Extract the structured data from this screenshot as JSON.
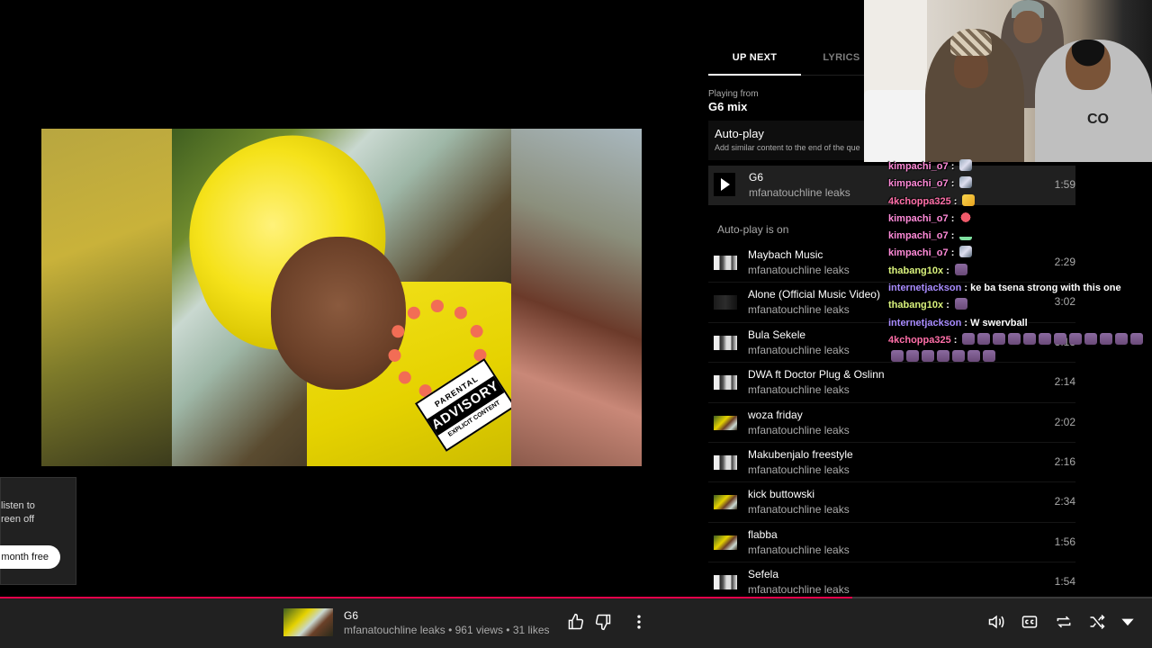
{
  "tabs": {
    "up_next": "UP NEXT",
    "lyrics": "LYRICS"
  },
  "playing_from": {
    "label": "Playing from",
    "name": "G6 mix"
  },
  "autoplay": {
    "title": "Auto-play",
    "description": "Add similar content to the end of the que",
    "status": "Auto-play is on"
  },
  "now_playing": {
    "title": "G6",
    "artist": "mfanatouchline leaks",
    "duration": "1:59"
  },
  "queue": [
    {
      "title": "Maybach Music",
      "artist": "mfanatouchline leaks",
      "duration": "2:29",
      "thumb": "t-bw"
    },
    {
      "title": "Alone (Official Music Video)",
      "artist": "mfanatouchline leaks",
      "duration": "3:02",
      "thumb": "t-dark"
    },
    {
      "title": "Bula Sekele",
      "artist": "mfanatouchline leaks",
      "duration": "3:13",
      "thumb": "t-bw"
    },
    {
      "title": "DWA ft Doctor Plug & Oslinn",
      "artist": "mfanatouchline leaks",
      "duration": "2:14",
      "thumb": "t-bw"
    },
    {
      "title": "woza friday",
      "artist": "mfanatouchline leaks",
      "duration": "2:02",
      "thumb": "t-yel"
    },
    {
      "title": "Makubenjalo freestyle",
      "artist": "mfanatouchline leaks",
      "duration": "2:16",
      "thumb": "t-bw"
    },
    {
      "title": "kick buttowski",
      "artist": "mfanatouchline leaks",
      "duration": "2:34",
      "thumb": "t-yel"
    },
    {
      "title": "flabba",
      "artist": "mfanatouchline leaks",
      "duration": "1:56",
      "thumb": "t-yel"
    },
    {
      "title": "Sefela",
      "artist": "mfanatouchline leaks",
      "duration": "1:54",
      "thumb": "t-bw"
    }
  ],
  "album_art": {
    "advisory": {
      "line1": "PARENTAL",
      "line2": "ADVISORY",
      "line3": "EXPLICIT CONTENT"
    }
  },
  "premium_popup": {
    "text": "listen to\nreen off",
    "button": "month free"
  },
  "webcam": {
    "shirt_text": "CO"
  },
  "chat": [
    {
      "user": "kimpachi_o7",
      "color": "#ff8ad8",
      "text": "",
      "emotes": [
        "e-rocket"
      ]
    },
    {
      "user": "kimpachi_o7",
      "color": "#ff8ad8",
      "text": "",
      "emotes": [
        "e-rocket"
      ]
    },
    {
      "user": "4kchoppa325",
      "color": "#ff6fa8",
      "text": "",
      "emotes": [
        "e-flex"
      ]
    },
    {
      "user": "kimpachi_o7",
      "color": "#ff8ad8",
      "text": "",
      "emotes": [
        "e-heart"
      ]
    },
    {
      "user": "kimpachi_o7",
      "color": "#ff8ad8",
      "text": "",
      "emotes": [
        "e-dots"
      ]
    },
    {
      "user": "kimpachi_o7",
      "color": "#ff8ad8",
      "text": "",
      "emotes": [
        "e-rocket"
      ]
    },
    {
      "user": "thabang10x",
      "color": "#d9f27c",
      "text": "",
      "emotes": [
        "e-face"
      ]
    },
    {
      "user": "internetjackson",
      "color": "#a98cff",
      "text": "ke ba tsena strong with this one",
      "emotes": []
    },
    {
      "user": "thabang10x",
      "color": "#d9f27c",
      "text": "",
      "emotes": [
        "e-face"
      ]
    },
    {
      "user": "internetjackson",
      "color": "#a98cff",
      "text": "W swervball",
      "emotes": []
    },
    {
      "user": "4kchoppa325",
      "color": "#ff6fa8",
      "text": "",
      "emotes": [
        "e-face",
        "e-face",
        "e-face",
        "e-face",
        "e-face",
        "e-face",
        "e-face",
        "e-face",
        "e-face",
        "e-face",
        "e-face",
        "e-face",
        "e-face",
        "e-face",
        "e-face",
        "e-face",
        "e-face",
        "e-face",
        "e-face"
      ]
    }
  ],
  "player_bar": {
    "title": "G6",
    "meta": "mfanatouchline leaks • 961 views • 31 likes",
    "progress": 0.74,
    "icons": [
      "thumbs-up-icon",
      "thumbs-down-icon",
      "more-vert-icon",
      "volume-icon",
      "captions-icon",
      "repeat-icon",
      "shuffle-icon",
      "expand-down-icon"
    ]
  },
  "colors": {
    "accent": "#e4004a",
    "background": "#000000",
    "bar": "#212121"
  }
}
